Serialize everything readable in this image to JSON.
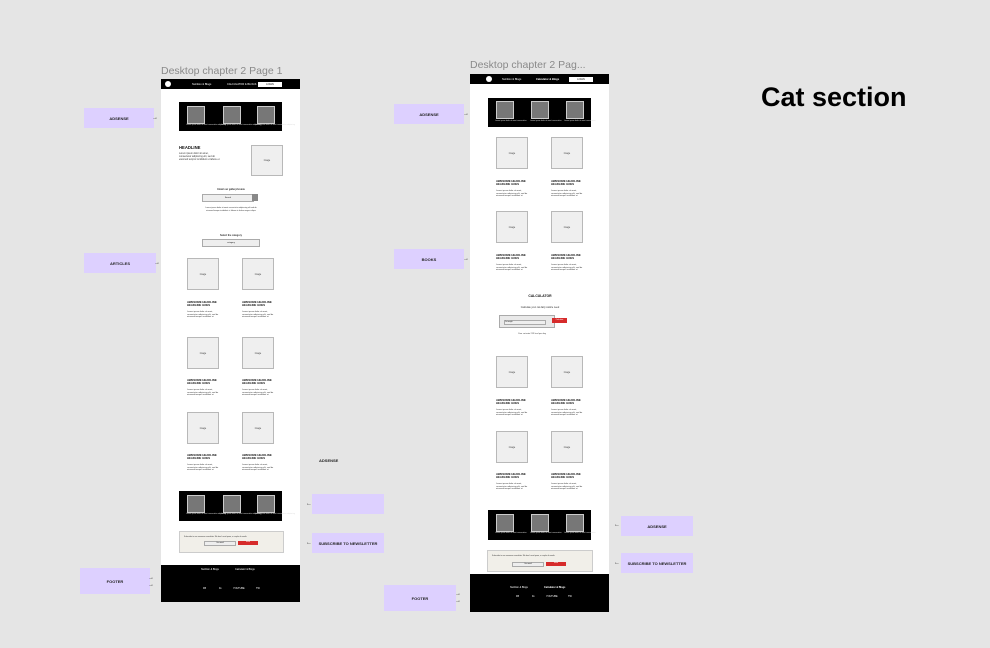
{
  "section_title": "Cat section",
  "frame1": {
    "title": "Desktop chapter 2 Page 1",
    "nav": {
      "brand": "Nutrition & Blogs",
      "link": "CALCULATOR & BLOGS",
      "button": "LOGIN"
    },
    "top_cards": [
      {
        "caption": "Lorem ipsum dolor sit amet\nconsectetur adipiscing"
      },
      {
        "caption": "Lorem ipsum dolor sit amet\nconsectetur adipiscing"
      },
      {
        "caption": "Lorem ipsum dolor sit amet\nconsectetur adipiscing"
      }
    ],
    "hero": {
      "headline": "HEADLINE",
      "text": "Lorem ipsum dolor sit amet,\nconsectetur adipiscing elit, sed do\neiusmod tempor incididunt ut labore et",
      "image": "image"
    },
    "email": {
      "label": "Email our gallery/review",
      "input": "Search",
      "text": "Lorem ipsum dolor sit amet consectetur adipiscing elit sed do\neiusmod tempor incididunt ut labore et dolore magna aliqua"
    },
    "category": {
      "label": "Select the category",
      "value": "category"
    },
    "articles": [
      {
        "image": "image",
        "headline": "AWESOME HEADLINE\nHEADLINE GOES",
        "text": "Lorem ipsum dolor sit amet,\nconsectetur adipiscing elit, sed do\neiusmod tempor incididunt ut"
      },
      {
        "image": "image",
        "headline": "AWESOME HEADLINE\nHEADLINE GOES",
        "text": "Lorem ipsum dolor sit amet,\nconsectetur adipiscing elit, sed do\neiusmod tempor incididunt ut"
      },
      {
        "image": "image",
        "headline": "AWESOME HEADLINE\nHEADLINE GOES",
        "text": "Lorem ipsum dolor sit amet,\nconsectetur adipiscing elit, sed do\neiusmod tempor incididunt ut"
      },
      {
        "image": "image",
        "headline": "AWESOME HEADLINE\nHEADLINE GOES",
        "text": "Lorem ipsum dolor sit amet,\nconsectetur adipiscing elit, sed do\neiusmod tempor incididunt ut"
      },
      {
        "image": "image",
        "headline": "AWESOME HEADLINE\nHEADLINE GOES",
        "text": "Lorem ipsum dolor sit amet,\nconsectetur adipiscing elit, sed do\neiusmod tempor incididunt ut"
      },
      {
        "image": "image",
        "headline": "AWESOME HEADLINE\nHEADLINE GOES",
        "text": "Lorem ipsum dolor sit amet,\nconsectetur adipiscing elit, sed do\neiusmod tempor incididunt ut"
      }
    ],
    "bottom_cards": [
      {
        "caption": "Lorem ipsum dolor sit amet\nconsectetur adipiscing"
      },
      {
        "caption": "Lorem ipsum dolor sit amet\nconsectetur adipiscing"
      },
      {
        "caption": "Lorem ipsum dolor sit amet\nconsectetur adipiscing"
      }
    ],
    "newsletter": {
      "text": "Subscribe to our awesome newsletter. We don't send spam, a couple of emails",
      "input": "Your email",
      "button": "Send"
    },
    "footer": {
      "brand": "Nutrition & Blogs",
      "link": "Calculator & Blogs",
      "items": [
        "FB",
        "IG",
        "YOUTUBE",
        "TW"
      ]
    }
  },
  "frame2": {
    "title": "Desktop chapter 2 Pag...",
    "nav": {
      "brand": "Nutrition & Blogs",
      "link": "Calculator & Blogs",
      "button": "LOGIN"
    },
    "top_cards": [
      {
        "caption": "Lorem ipsum dolor sit\namet consectetur"
      },
      {
        "caption": "Lorem ipsum dolor sit\namet consectetur"
      },
      {
        "caption": "Lorem ipsum dolor sit\namet consectetur"
      }
    ],
    "books_top": [
      {
        "image": "image",
        "headline": "AWESOME HEADLINE\nHEADLINE GOES",
        "text": "Lorem ipsum dolor sit amet,\nconsectetur adipiscing elit, sed do\neiusmod tempor incididunt ut"
      },
      {
        "image": "image",
        "headline": "AWESOME HEADLINE\nHEADLINE GOES",
        "text": "Lorem ipsum dolor sit amet,\nconsectetur adipiscing elit, sed do\neiusmod tempor incididunt ut"
      },
      {
        "image": "image",
        "headline": "AWESOME HEADLINE\nHEADLINE GOES",
        "text": "Lorem ipsum dolor sit amet,\nconsectetur adipiscing elit, sed do\neiusmod tempor incididunt ut"
      },
      {
        "image": "image",
        "headline": "AWESOME HEADLINE\nHEADLINE GOES",
        "text": "Lorem ipsum dolor sit amet,\nconsectetur adipiscing elit, sed do\neiusmod tempor incididunt ut"
      }
    ],
    "calculator": {
      "title": "CALCULATOR",
      "label": "Calculate your cat daily calorie need",
      "input": "Cat weight",
      "button": "Calculate",
      "result": "Your cat eats 213 kcal per day"
    },
    "books_bottom": [
      {
        "image": "image",
        "headline": "AWESOME HEADLINE\nHEADLINE GOES",
        "text": "Lorem ipsum dolor sit amet,\nconsectetur adipiscing elit, sed do\neiusmod tempor incididunt ut"
      },
      {
        "image": "image",
        "headline": "AWESOME HEADLINE\nHEADLINE GOES",
        "text": "Lorem ipsum dolor sit amet,\nconsectetur adipiscing elit, sed do\neiusmod tempor incididunt ut"
      },
      {
        "image": "image",
        "headline": "AWESOME HEADLINE\nHEADLINE GOES",
        "text": "Lorem ipsum dolor sit amet,\nconsectetur adipiscing elit, sed do\neiusmod tempor incididunt ut"
      },
      {
        "image": "image",
        "headline": "AWESOME HEADLINE\nHEADLINE GOES",
        "text": "Lorem ipsum dolor sit amet,\nconsectetur adipiscing elit, sed do\neiusmod tempor incididunt ut"
      }
    ],
    "bottom_cards": [
      {
        "caption": "Lorem ipsum dolor sit\namet consectetur"
      },
      {
        "caption": "Lorem ipsum dolor sit\namet consectetur"
      },
      {
        "caption": "Lorem ipsum dolor sit\namet consectetur"
      }
    ],
    "newsletter": {
      "text": "Subscribe to our awesome newsletter. We don't send spam, a couple of emails",
      "input": "Your email",
      "button": "Send"
    },
    "footer": {
      "brand": "Nutrition & Blogs",
      "link": "Calculator & Blogs",
      "items": [
        "FB",
        "IG",
        "YOUTUBE",
        "TW"
      ]
    }
  },
  "annotations": {
    "f1_adsense": "ADSENSE",
    "f1_articles": "ARTICLES",
    "f1_adsense2": "ADSENSE",
    "f1_subscribe": "SUBSCRIBE TO NEWSLETTER",
    "f1_footer": "FOOTER",
    "f2_adsense": "ADSENSE",
    "f2_books": "BOOKS",
    "f2_adsense2": "ADSENSE",
    "f2_subscribe": "SUBSCRIBE TO NEWSLETTER",
    "f2_footer": "FOOTER"
  },
  "colors": {
    "canvas": "#e5e5e5",
    "sticky": "#ddd0ff",
    "accent_red": "#d62b2b"
  }
}
